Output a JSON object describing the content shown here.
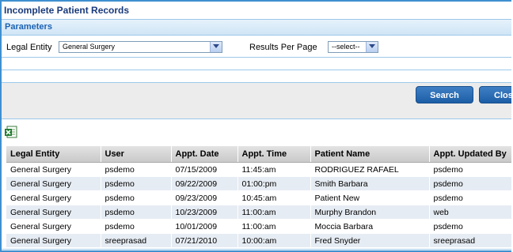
{
  "window": {
    "title": "Incomplete Patient Records"
  },
  "parameters": {
    "heading": "Parameters",
    "legal_entity_label": "Legal Entity",
    "legal_entity_value": "General Surgery",
    "results_per_page_label": "Results Per Page",
    "results_per_page_value": "--select--"
  },
  "buttons": {
    "search": "Search",
    "close": "Close"
  },
  "table": {
    "columns": [
      "Legal Entity",
      "User",
      "Appt. Date",
      "Appt. Time",
      "Patient Name",
      "Appt. Updated By"
    ],
    "rows": [
      [
        "General Surgery",
        "psdemo",
        "07/15/2009",
        "11:45:am",
        "RODRIGUEZ RAFAEL",
        "psdemo"
      ],
      [
        "General Surgery",
        "psdemo",
        "09/22/2009",
        "01:00:pm",
        "Smith Barbara",
        "psdemo"
      ],
      [
        "General Surgery",
        "psdemo",
        "09/23/2009",
        "10:45:am",
        "Patient New",
        "psdemo"
      ],
      [
        "General Surgery",
        "psdemo",
        "10/23/2009",
        "11:00:am",
        "Murphy Brandon",
        "web"
      ],
      [
        "General Surgery",
        "psdemo",
        "10/01/2009",
        "11:00:am",
        "Moccia Barbara",
        "psdemo"
      ],
      [
        "General Surgery",
        "sreeprasad",
        "07/21/2010",
        "10:00:am",
        "Fred Snyder",
        "sreeprasad"
      ]
    ]
  },
  "icons": {
    "export": "excel-export-icon",
    "dropdown": "chevron-down-icon"
  },
  "colors": {
    "accent": "#1c5ea6",
    "title": "#1a3a7c",
    "border": "#3f8fd0"
  }
}
